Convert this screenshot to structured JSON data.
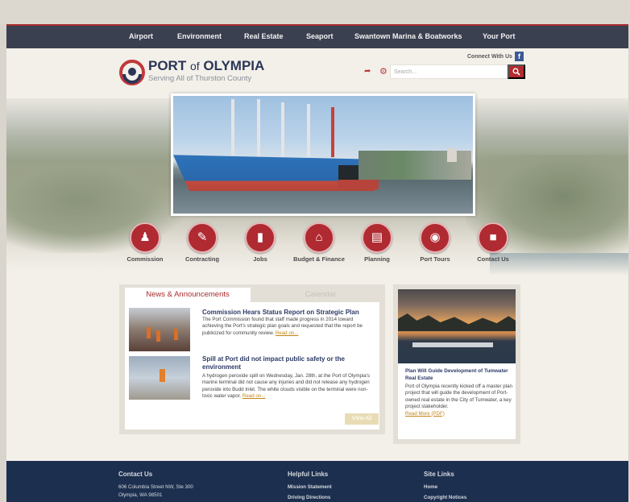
{
  "nav": {
    "items": [
      {
        "label": "Airport"
      },
      {
        "label": "Environment"
      },
      {
        "label": "Real Estate"
      },
      {
        "label": "Seaport"
      },
      {
        "label": "Swantown Marina & Boatworks"
      },
      {
        "label": "Your Port"
      }
    ]
  },
  "header": {
    "logo_title_port": "PORT",
    "logo_title_of": "of",
    "logo_title_olympia": "OLYMPIA",
    "logo_subtitle": "Serving All of Thurston County",
    "connect_label": "Connect With Us",
    "facebook_glyph": "f",
    "search_placeholder": "Search..."
  },
  "quick_links": [
    {
      "label": "Commission",
      "icon": "people-icon"
    },
    {
      "label": "Contracting",
      "icon": "contract-icon"
    },
    {
      "label": "Jobs",
      "icon": "briefcase-icon"
    },
    {
      "label": "Budget & Finance",
      "icon": "building-icon"
    },
    {
      "label": "Planning",
      "icon": "document-icon"
    },
    {
      "label": "Port Tours",
      "icon": "camera-icon"
    },
    {
      "label": "Contact Us",
      "icon": "contact-card-icon"
    }
  ],
  "news": {
    "tab_active": "News & Announcements",
    "tab_inactive": "Calendar",
    "items": [
      {
        "title": "Commission Hears Status Report on Strategic Plan",
        "text": "The Port Commission found that staff made progress in 2014 toward achieving the Port's strategic plan goals and requested that the report be publicized for community review.",
        "link": "Read on..."
      },
      {
        "title": "Spill at Port did not impact public safety or the environment",
        "text": "A hydrogen peroxide spill on Wednesday, Jan. 28th, at the Port of Olympia's marine terminal did not cause any injuries and did not release any hydrogen peroxide into Budd Inlet. The white clouds visible on the terminal were non-toxic water vapor.",
        "link": "Read on..."
      }
    ],
    "view_all": "View All"
  },
  "feature": {
    "title": "Plan Will Guide Development of Tumwater Real Estate",
    "text": "Port of Olympia recently kicked off a master plan project that will guide the development of Port-owned real estate in the City of Tumwater, a key project stakeholder.",
    "link": "Read More (PDF)"
  },
  "footer": {
    "contact_heading": "Contact Us",
    "contact_lines": [
      "606 Columbia Street NW, Ste 300",
      "Olympia, WA 98501"
    ],
    "helpful_heading": "Helpful Links",
    "helpful_links": [
      "Mission Statement",
      "Driving Directions"
    ],
    "site_heading": "Site Links",
    "site_links": [
      "Home",
      "Copyright Notices"
    ]
  },
  "colors": {
    "accent_red": "#b02a31",
    "nav_bg": "#3a4050",
    "footer_bg": "#1c2f4e",
    "title_navy": "#2c3a66",
    "link_gold": "#c58514"
  }
}
